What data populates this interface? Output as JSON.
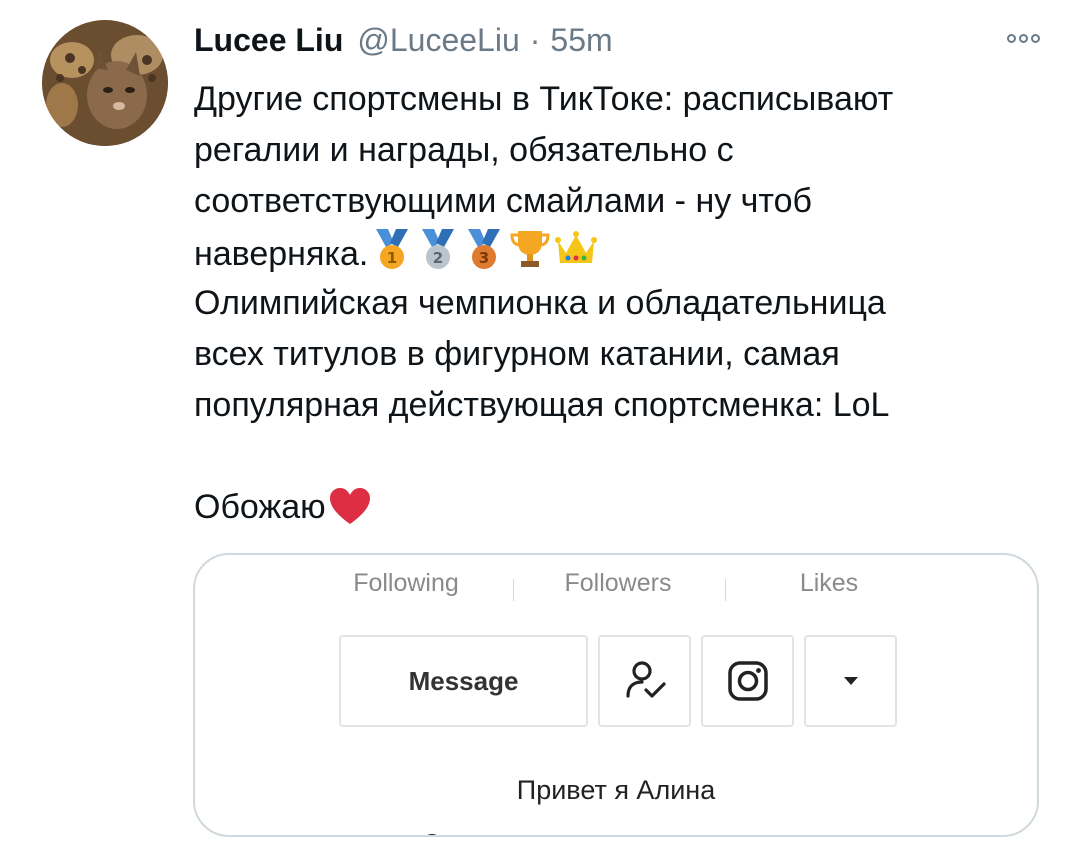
{
  "tweet": {
    "name": "Lucee Liu",
    "handle": "@LuceeLiu",
    "separator": "·",
    "time": "55m",
    "lines": [
      "Другие спортсмены в ТикТоке: расписывают",
      "регалии и награды, обязательно с",
      "соответствующими смайлами - ну чтоб",
      "наверняка.",
      "Олимпийская чемпионка и обладательница",
      "всех титулов в фигурном катании, самая",
      "популярная действующая спортсменка: LoL",
      "Обожаю"
    ],
    "emoji_row": [
      "first-place-medal",
      "second-place-medal",
      "third-place-medal",
      "trophy",
      "crown"
    ],
    "heart_emoji": "red-heart"
  },
  "card": {
    "stats": [
      "Following",
      "Followers",
      "Likes"
    ],
    "message_label": "Message",
    "icons": [
      "user-check-icon",
      "instagram-icon",
      "dropdown-triangle-icon"
    ],
    "bio": "Привет я Алина"
  },
  "colors": {
    "text": "#0f1419",
    "muted": "#6b7a87",
    "card_border": "#cfd9de",
    "gold": "#f5a623",
    "silver": "#b9c4cc",
    "bronze": "#e07a30",
    "ribbon": "#4a90d9",
    "heart": "#dd2e44"
  }
}
